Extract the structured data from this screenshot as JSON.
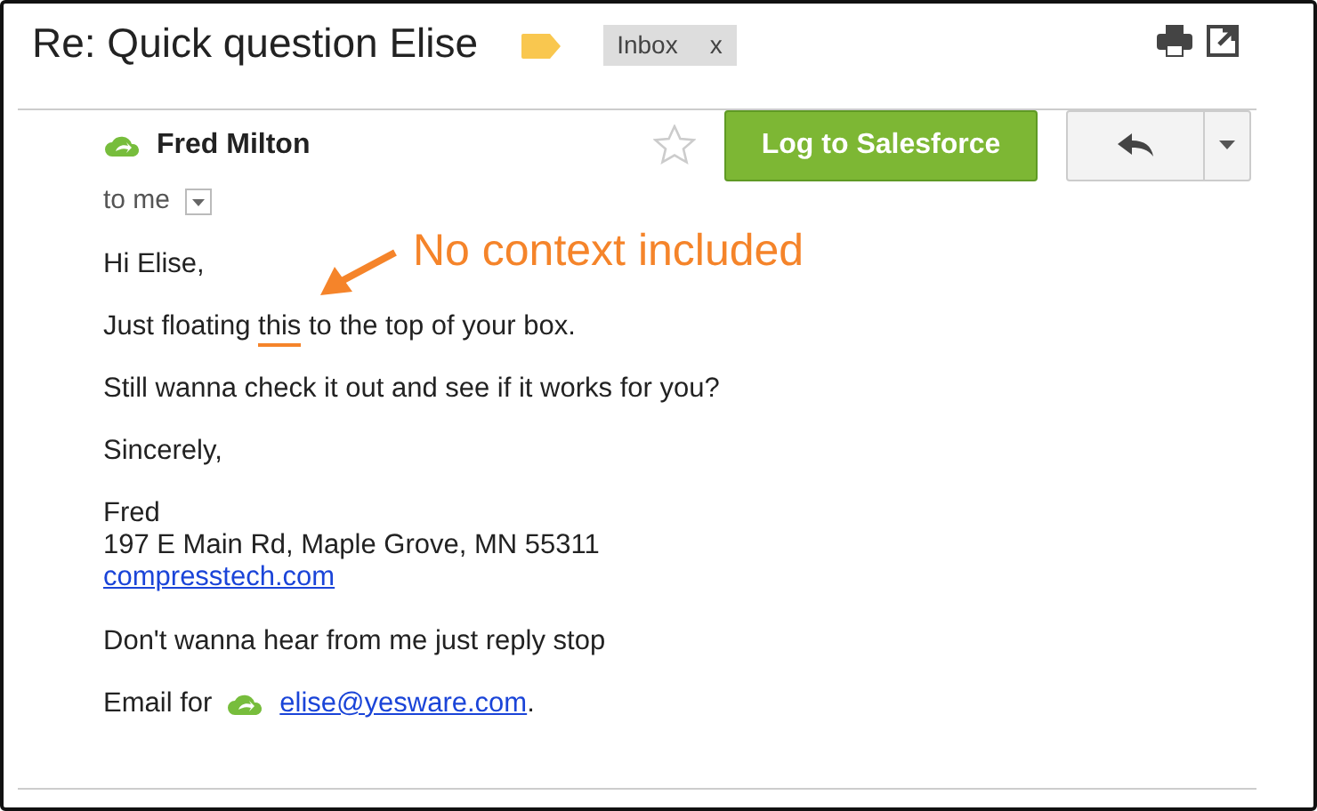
{
  "subject": "Re: Quick question Elise",
  "label_tag": {
    "text": "Inbox",
    "remove": "x"
  },
  "sender": {
    "name": "Fred Milton",
    "recipient": "to me"
  },
  "starred": false,
  "log_button": "Log to Salesforce",
  "annotation": "No context included",
  "body": [
    {
      "kind": "text",
      "text": "Hi Elise,"
    },
    {
      "kind": "highlight",
      "before": "Just floating ",
      "mark": "this",
      "after": " to the top of your box."
    },
    {
      "kind": "text",
      "text": "Still wanna check it out and see if it works for you?"
    },
    {
      "kind": "text",
      "text": "Sincerely,"
    },
    {
      "kind": "signature",
      "lines": [
        "Fred",
        "197 E Main Rd, Maple Grove, MN 55311"
      ],
      "link": "compresstech.com"
    },
    {
      "kind": "text",
      "text": "Don't wanna hear from me just reply stop"
    },
    {
      "kind": "email",
      "before": "Email for",
      "link": "elise@yesware.com",
      "after": "."
    }
  ]
}
